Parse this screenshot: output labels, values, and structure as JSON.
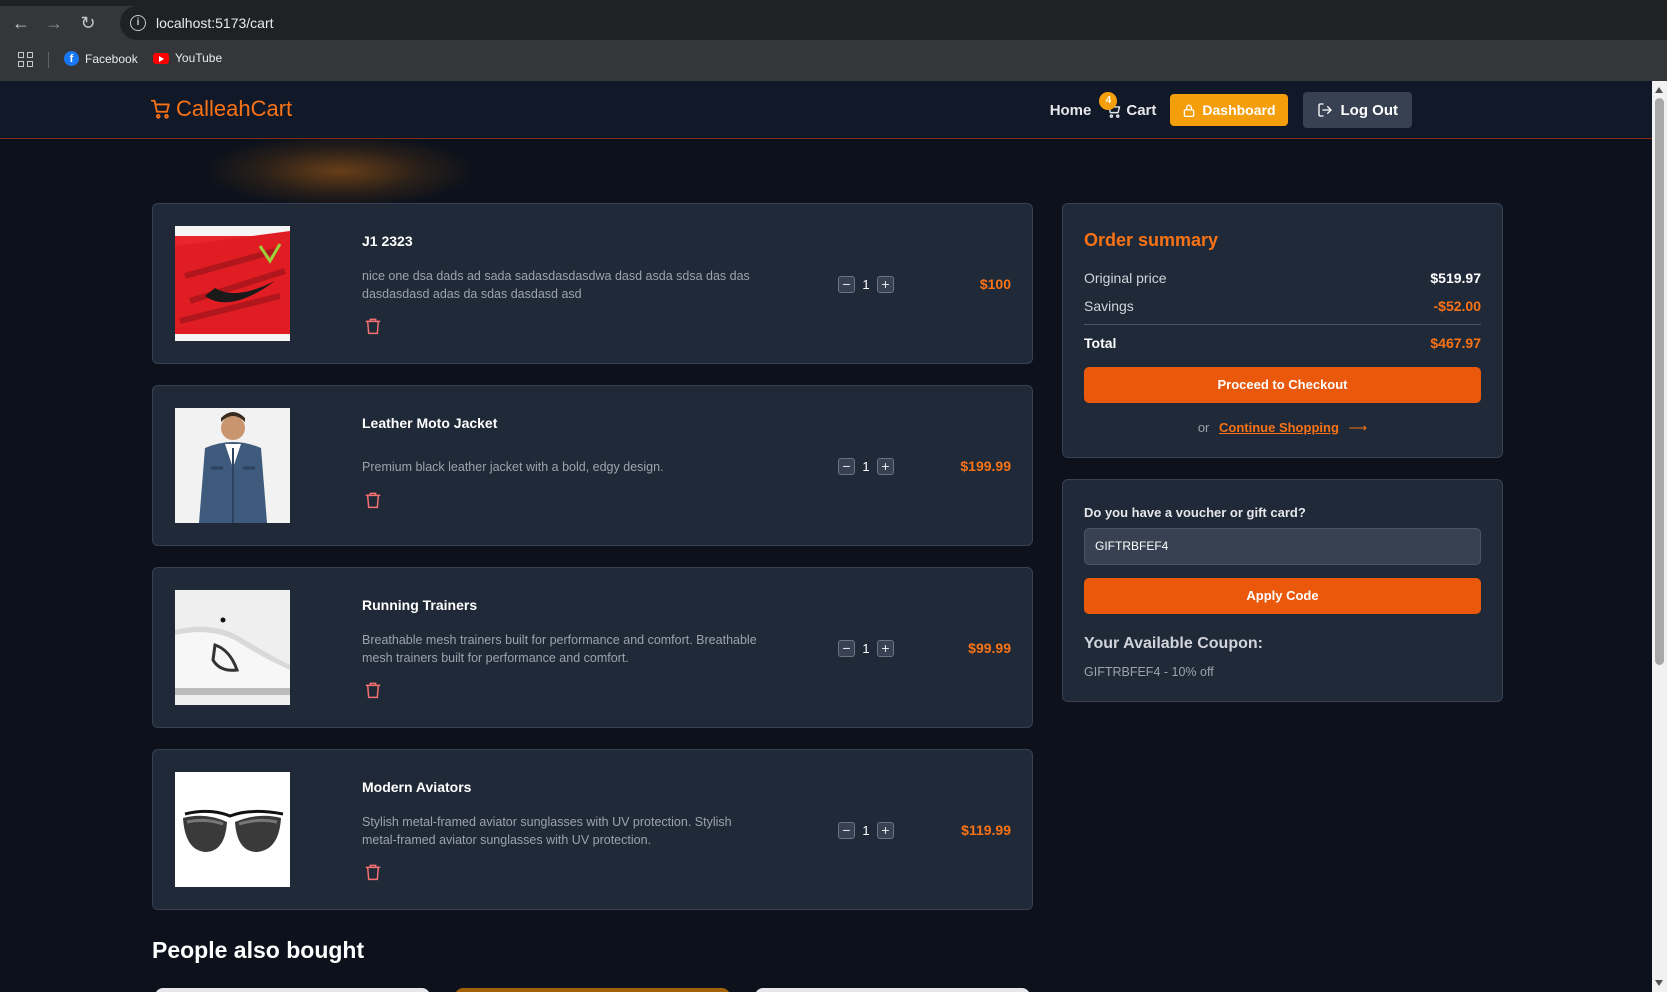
{
  "browser": {
    "url": "localhost:5173/cart",
    "bookmarks": [
      "Facebook",
      "YouTube"
    ]
  },
  "header": {
    "brand": "CalleahCart",
    "nav_home": "Home",
    "nav_cart": "Cart",
    "cart_count": "4",
    "dashboard_label": "Dashboard",
    "logout_label": "Log Out"
  },
  "cart": {
    "items": [
      {
        "name": "J1 2323",
        "description": "nice one dsa dads ad sada sadasdasdasdwa dasd asda sdsa das das dasdasdasd adas da sdas dasdasd asd",
        "quantity": "1",
        "price": "$100",
        "image_icon": "red-sneaker-image"
      },
      {
        "name": "Leather Moto Jacket",
        "description": "Premium black leather jacket with a bold, edgy design.",
        "quantity": "1",
        "price": "$199.99",
        "image_icon": "denim-jacket-model-image"
      },
      {
        "name": "Running Trainers",
        "description": "Breathable mesh trainers built for performance and comfort. Breathable mesh trainers built for performance and comfort.",
        "quantity": "1",
        "price": "$99.99",
        "image_icon": "white-trainer-image"
      },
      {
        "name": "Modern Aviators",
        "description": "Stylish metal-framed aviator sunglasses with UV protection. Stylish metal-framed aviator sunglasses with UV protection.",
        "quantity": "1",
        "price": "$119.99",
        "image_icon": "aviator-sunglasses-image"
      }
    ]
  },
  "summary": {
    "title": "Order summary",
    "original_label": "Original price",
    "original_value": "$519.97",
    "savings_label": "Savings",
    "savings_value": "-$52.00",
    "total_label": "Total",
    "total_value": "$467.97",
    "checkout_label": "Proceed to Checkout",
    "or_text": "or",
    "continue_label": "Continue Shopping"
  },
  "voucher": {
    "label": "Do you have a voucher or gift card?",
    "input_value": "GIFTRBFEF4",
    "apply_label": "Apply Code",
    "coupon_title": "Your Available Coupon:",
    "coupon_text": "GIFTRBFEF4 - 10% off"
  },
  "recommendations": {
    "title": "People also bought"
  },
  "colors": {
    "accent": "#f97316",
    "button": "#ea580c",
    "dashboard": "#f59e0b",
    "panel": "#1f2937",
    "background": "#0c111c"
  }
}
